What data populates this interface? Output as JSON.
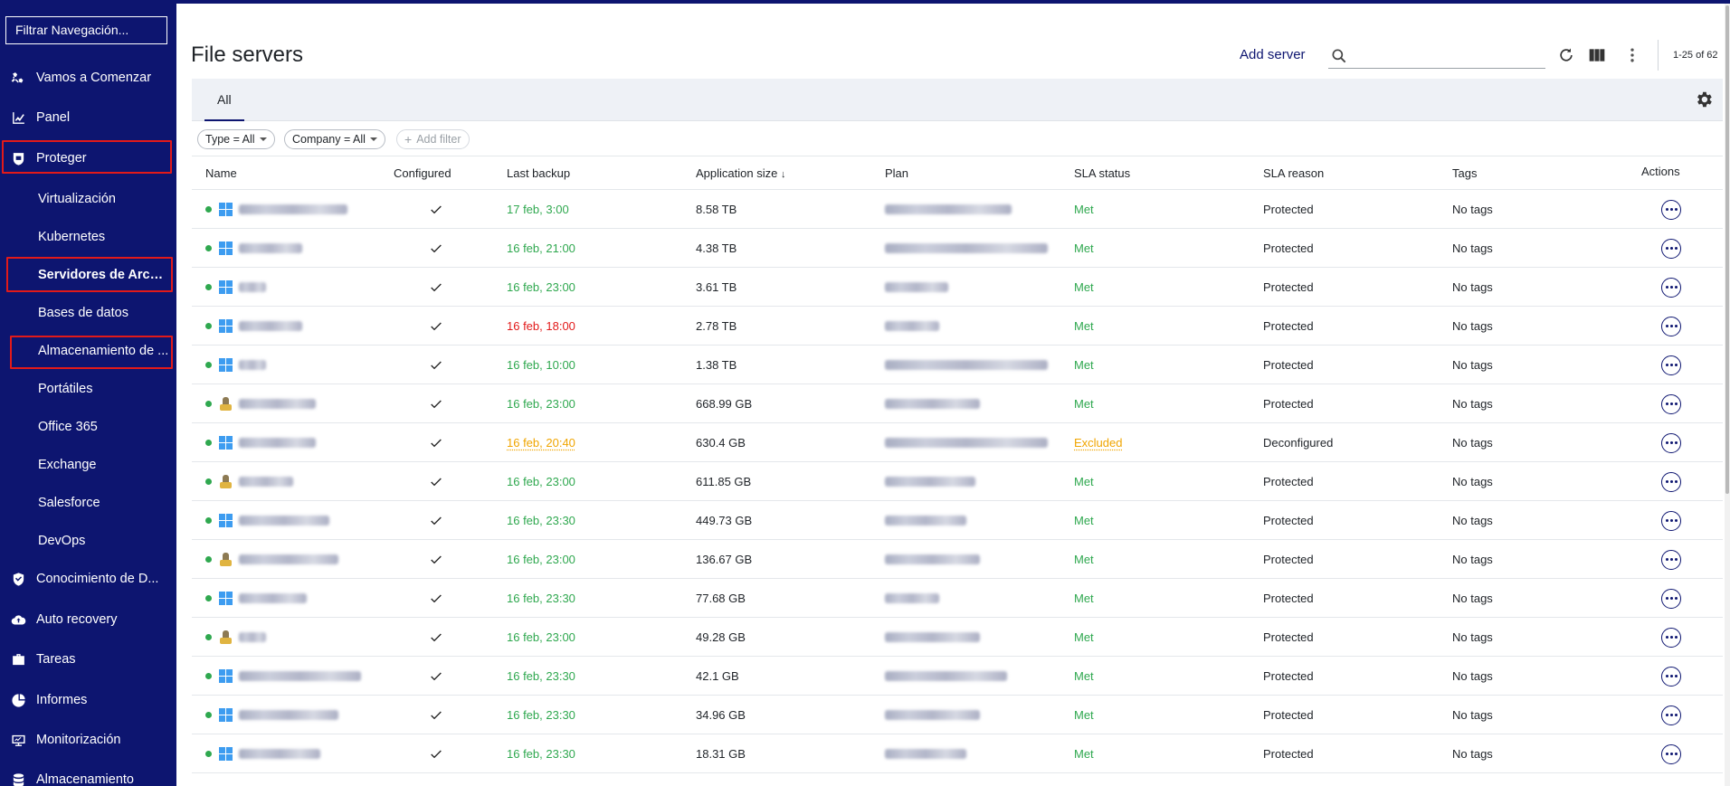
{
  "sidebar": {
    "filter_placeholder": "Filtrar Navegación...",
    "items": [
      {
        "label": "Vamos a Comenzar",
        "icon": "tools-icon"
      },
      {
        "label": "Panel",
        "icon": "dashboard-icon"
      },
      {
        "label": "Proteger",
        "icon": "shield-icon"
      },
      {
        "label": "Conocimiento de D...",
        "icon": "shield-check-icon"
      },
      {
        "label": "Auto recovery",
        "icon": "cloud-recovery-icon"
      },
      {
        "label": "Tareas",
        "icon": "briefcase-icon"
      },
      {
        "label": "Informes",
        "icon": "chart-icon"
      },
      {
        "label": "Monitorización",
        "icon": "monitor-icon"
      },
      {
        "label": "Almacenamiento",
        "icon": "database-icon"
      }
    ],
    "subitems": [
      "Virtualización",
      "Kubernetes",
      "Servidores de Archi...",
      "Bases de datos",
      "Almacenamiento de ...",
      "Portátiles",
      "Office 365",
      "Exchange",
      "Salesforce",
      "DevOps"
    ]
  },
  "header": {
    "title": "File servers",
    "add_server": "Add server",
    "pager": "1-25 of 62"
  },
  "tabs": {
    "all": "All"
  },
  "filters": {
    "type": "Type = All",
    "company": "Company = All",
    "add": "Add filter"
  },
  "table": {
    "columns": {
      "name": "Name",
      "configured": "Configured",
      "last_backup": "Last backup",
      "app_size": "Application size",
      "plan": "Plan",
      "sla_status": "SLA status",
      "sla_reason": "SLA reason",
      "tags": "Tags",
      "actions": "Actions"
    },
    "rows": [
      {
        "os": "windows",
        "last_backup": "17 feb, 3:00",
        "backup_status": "green",
        "size": "8.58 TB",
        "sla": "Met",
        "reason": "Protected",
        "tags": "No tags"
      },
      {
        "os": "windows",
        "last_backup": "16 feb, 21:00",
        "backup_status": "green",
        "size": "4.38 TB",
        "sla": "Met",
        "reason": "Protected",
        "tags": "No tags"
      },
      {
        "os": "windows",
        "last_backup": "16 feb, 23:00",
        "backup_status": "green",
        "size": "3.61 TB",
        "sla": "Met",
        "reason": "Protected",
        "tags": "No tags"
      },
      {
        "os": "windows",
        "last_backup": "16 feb, 18:00",
        "backup_status": "red",
        "size": "2.78 TB",
        "sla": "Met",
        "reason": "Protected",
        "tags": "No tags"
      },
      {
        "os": "windows",
        "last_backup": "16 feb, 10:00",
        "backup_status": "green",
        "size": "1.38 TB",
        "sla": "Met",
        "reason": "Protected",
        "tags": "No tags"
      },
      {
        "os": "linux",
        "last_backup": "16 feb, 23:00",
        "backup_status": "green",
        "size": "668.99 GB",
        "sla": "Met",
        "reason": "Protected",
        "tags": "No tags"
      },
      {
        "os": "windows",
        "last_backup": "16 feb, 20:40",
        "backup_status": "orange",
        "size": "630.4 GB",
        "sla": "Excluded",
        "reason": "Deconfigured",
        "tags": "No tags"
      },
      {
        "os": "linux",
        "last_backup": "16 feb, 23:00",
        "backup_status": "green",
        "size": "611.85 GB",
        "sla": "Met",
        "reason": "Protected",
        "tags": "No tags"
      },
      {
        "os": "windows",
        "last_backup": "16 feb, 23:30",
        "backup_status": "green",
        "size": "449.73 GB",
        "sla": "Met",
        "reason": "Protected",
        "tags": "No tags"
      },
      {
        "os": "linux",
        "last_backup": "16 feb, 23:00",
        "backup_status": "green",
        "size": "136.67 GB",
        "sla": "Met",
        "reason": "Protected",
        "tags": "No tags"
      },
      {
        "os": "windows",
        "last_backup": "16 feb, 23:30",
        "backup_status": "green",
        "size": "77.68 GB",
        "sla": "Met",
        "reason": "Protected",
        "tags": "No tags"
      },
      {
        "os": "linux",
        "last_backup": "16 feb, 23:00",
        "backup_status": "green",
        "size": "49.28 GB",
        "sla": "Met",
        "reason": "Protected",
        "tags": "No tags"
      },
      {
        "os": "windows",
        "last_backup": "16 feb, 23:30",
        "backup_status": "green",
        "size": "42.1 GB",
        "sla": "Met",
        "reason": "Protected",
        "tags": "No tags"
      },
      {
        "os": "windows",
        "last_backup": "16 feb, 23:30",
        "backup_status": "green",
        "size": "34.96 GB",
        "sla": "Met",
        "reason": "Protected",
        "tags": "No tags"
      },
      {
        "os": "windows",
        "last_backup": "16 feb, 23:30",
        "backup_status": "green",
        "size": "18.31 GB",
        "sla": "Met",
        "reason": "Protected",
        "tags": "No tags"
      }
    ]
  },
  "colors": {
    "sidebar_bg": "#0d1570",
    "highlight": "#e21a1a",
    "status_green": "#2fa84f",
    "status_red": "#e21a1a",
    "status_orange": "#f0a500"
  }
}
